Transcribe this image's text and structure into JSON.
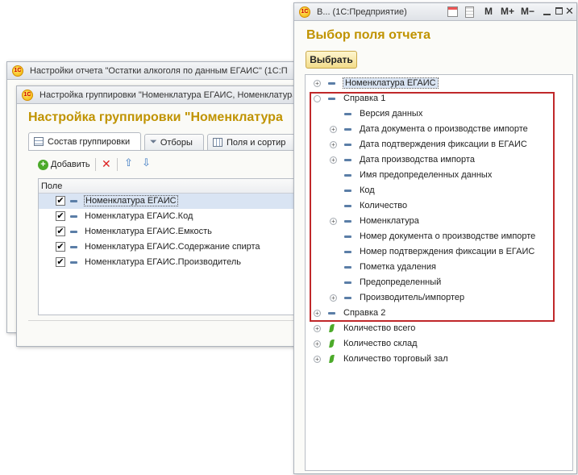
{
  "back_window": {
    "title": "Настройки отчета \"Остатки алкоголя по данным ЕГАИС\"  (1С:П"
  },
  "group_window": {
    "title": "Настройка группировки \"Номенклатура ЕГАИС, Номенклатура",
    "header": "Настройка группировки \"Номенклатура",
    "tabs": [
      {
        "label": "Состав группировки"
      },
      {
        "label": "Отборы"
      },
      {
        "label": "Поля и сортир"
      }
    ],
    "toolbar": {
      "add_label": "Добавить"
    },
    "column_header": "Поле",
    "rows": [
      {
        "label": "Номенклатура ЕГАИС",
        "checked": true,
        "selected": true
      },
      {
        "label": "Номенклатура ЕГАИС.Код",
        "checked": true,
        "selected": false
      },
      {
        "label": "Номенклатура ЕГАИС.Емкость",
        "checked": true,
        "selected": false
      },
      {
        "label": "Номенклатура ЕГАИС.Содержание спирта",
        "checked": true,
        "selected": false
      },
      {
        "label": "Номенклатура ЕГАИС.Производитель",
        "checked": true,
        "selected": false
      }
    ]
  },
  "field_window": {
    "title": "В...  (1С:Предприятие)",
    "title_buttons": {
      "m": "M",
      "m_plus": "M+",
      "m_minus": "M−"
    },
    "header": "Выбор поля отчета",
    "select_button": "Выбрать",
    "tree": [
      {
        "label": "Номенклатура ЕГАИС",
        "level": 0,
        "expand": "plus",
        "icon": "dash",
        "selected": true
      },
      {
        "label": "Справка 1",
        "level": 0,
        "expand": "minus",
        "icon": "dash"
      },
      {
        "label": "Версия данных",
        "level": 1,
        "expand": "none",
        "icon": "dash"
      },
      {
        "label": "Дата документа о производстве импорте",
        "level": 1,
        "expand": "plus",
        "icon": "dash"
      },
      {
        "label": "Дата подтверждения фиксации в ЕГАИС",
        "level": 1,
        "expand": "plus",
        "icon": "dash"
      },
      {
        "label": "Дата производства импорта",
        "level": 1,
        "expand": "plus",
        "icon": "dash"
      },
      {
        "label": "Имя предопределенных данных",
        "level": 1,
        "expand": "none",
        "icon": "dash"
      },
      {
        "label": "Код",
        "level": 1,
        "expand": "none",
        "icon": "dash"
      },
      {
        "label": "Количество",
        "level": 1,
        "expand": "none",
        "icon": "dash"
      },
      {
        "label": "Номенклатура",
        "level": 1,
        "expand": "plus",
        "icon": "dash"
      },
      {
        "label": "Номер документа о производстве импорте",
        "level": 1,
        "expand": "none",
        "icon": "dash"
      },
      {
        "label": "Номер подтверждения фиксации в ЕГАИС",
        "level": 1,
        "expand": "none",
        "icon": "dash"
      },
      {
        "label": "Пометка удаления",
        "level": 1,
        "expand": "none",
        "icon": "dash"
      },
      {
        "label": "Предопределенный",
        "level": 1,
        "expand": "none",
        "icon": "dash"
      },
      {
        "label": "Производитель/импортер",
        "level": 1,
        "expand": "plus",
        "icon": "dash"
      },
      {
        "label": "Справка 2",
        "level": 0,
        "expand": "plus",
        "icon": "dash"
      },
      {
        "label": "Количество всего",
        "level": 0,
        "expand": "plus",
        "icon": "leaf"
      },
      {
        "label": "Количество склад",
        "level": 0,
        "expand": "plus",
        "icon": "leaf"
      },
      {
        "label": "Количество торговый зал",
        "level": 0,
        "expand": "plus",
        "icon": "leaf"
      }
    ]
  },
  "colors": {
    "accent": "#c09300",
    "highlight_border": "#c0282a",
    "selection": "#d9e4f3"
  }
}
